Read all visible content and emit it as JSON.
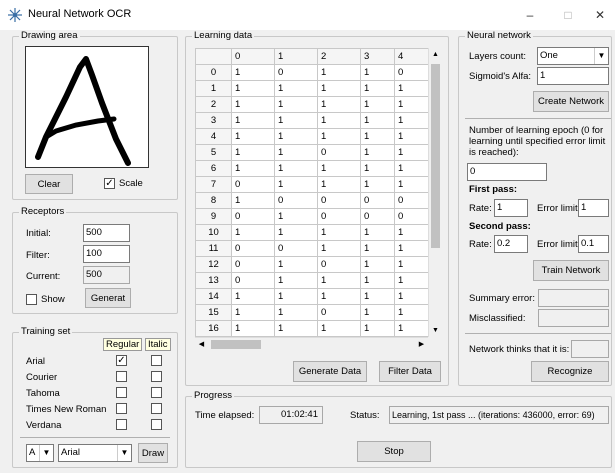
{
  "window": {
    "title": "Neural Network OCR",
    "minimize": "–",
    "maximize": "□",
    "close": "✕"
  },
  "drawing": {
    "legend": "Drawing area",
    "clear_label": "Clear",
    "scale_label": "Scale",
    "scale_checked": true
  },
  "receptors": {
    "legend": "Receptors",
    "initial_label": "Initial:",
    "initial_value": "500",
    "filter_label": "Filter:",
    "filter_value": "100",
    "current_label": "Current:",
    "current_value": "500",
    "show_label": "Show",
    "generate_label": "Generat"
  },
  "training": {
    "legend": "Training set",
    "regular_label": "Regular",
    "italic_label": "Italic",
    "fonts": [
      {
        "name": "Arial",
        "regular": true,
        "italic": false
      },
      {
        "name": "Courier",
        "regular": false,
        "italic": false
      },
      {
        "name": "Tahoma",
        "regular": false,
        "italic": false
      },
      {
        "name": "Times New Roman",
        "regular": false,
        "italic": false
      },
      {
        "name": "Verdana",
        "regular": false,
        "italic": false
      }
    ],
    "letter_value": "A",
    "font_value": "Arial",
    "draw_label": "Draw"
  },
  "learning": {
    "legend": "Learning data",
    "columns": [
      "0",
      "1",
      "2",
      "3",
      "4"
    ],
    "rows": [
      {
        "index": "0",
        "cells": [
          "1",
          "0",
          "1",
          "1",
          "0"
        ]
      },
      {
        "index": "1",
        "cells": [
          "1",
          "1",
          "1",
          "1",
          "1"
        ]
      },
      {
        "index": "2",
        "cells": [
          "1",
          "1",
          "1",
          "1",
          "1"
        ]
      },
      {
        "index": "3",
        "cells": [
          "1",
          "1",
          "1",
          "1",
          "1"
        ]
      },
      {
        "index": "4",
        "cells": [
          "1",
          "1",
          "1",
          "1",
          "1"
        ]
      },
      {
        "index": "5",
        "cells": [
          "1",
          "1",
          "0",
          "1",
          "1"
        ]
      },
      {
        "index": "6",
        "cells": [
          "1",
          "1",
          "1",
          "1",
          "1"
        ]
      },
      {
        "index": "7",
        "cells": [
          "0",
          "1",
          "1",
          "1",
          "1"
        ]
      },
      {
        "index": "8",
        "cells": [
          "1",
          "0",
          "0",
          "0",
          "0"
        ]
      },
      {
        "index": "9",
        "cells": [
          "0",
          "1",
          "0",
          "0",
          "0"
        ]
      },
      {
        "index": "10",
        "cells": [
          "1",
          "1",
          "1",
          "1",
          "1"
        ]
      },
      {
        "index": "11",
        "cells": [
          "0",
          "0",
          "1",
          "1",
          "1"
        ]
      },
      {
        "index": "12",
        "cells": [
          "0",
          "1",
          "0",
          "1",
          "1"
        ]
      },
      {
        "index": "13",
        "cells": [
          "0",
          "1",
          "1",
          "1",
          "1"
        ]
      },
      {
        "index": "14",
        "cells": [
          "1",
          "1",
          "1",
          "1",
          "1"
        ]
      },
      {
        "index": "15",
        "cells": [
          "1",
          "1",
          "0",
          "1",
          "1"
        ]
      },
      {
        "index": "16",
        "cells": [
          "1",
          "1",
          "1",
          "1",
          "1"
        ]
      }
    ],
    "generate_label": "Generate Data",
    "filter_label": "Filter Data"
  },
  "network": {
    "legend": "Neural network",
    "layers_label": "Layers count:",
    "layers_value": "One",
    "sigmoid_label": "Sigmoid's Alfa:",
    "sigmoid_value": "1",
    "create_label": "Create Network",
    "epoch_text": "Number of learning epoch (0 for learning until specified error limit is reached):",
    "epoch_value": "0",
    "first_pass_label": "First pass:",
    "first_rate_label": "Rate:",
    "first_rate_value": "1",
    "first_error_label": "Error limit",
    "first_error_value": "1",
    "second_pass_label": "Second pass:",
    "second_rate_label": "Rate:",
    "second_rate_value": "0.2",
    "second_error_label": "Error limit",
    "second_error_value": "0.1",
    "train_label": "Train Network",
    "summary_label": "Summary error:",
    "summary_value": "",
    "misclassified_label": "Misclassified:",
    "misclassified_value": "",
    "thinks_label": "Network thinks that it is:",
    "thinks_value": "",
    "recognize_label": "Recognize"
  },
  "progress": {
    "legend": "Progress",
    "elapsed_label": "Time elapsed:",
    "elapsed_value": "01:02:41",
    "status_label": "Status:",
    "status_value": "Learning, 1st pass ... (iterations: 436000, error: 69)",
    "stop_label": "Stop"
  }
}
